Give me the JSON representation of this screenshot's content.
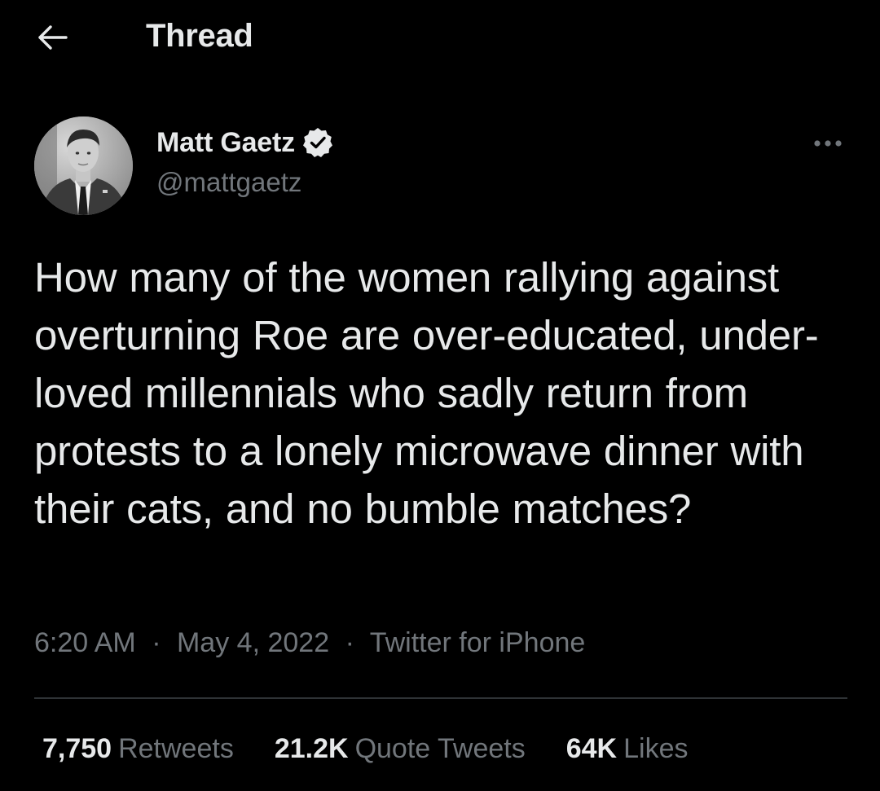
{
  "header": {
    "title": "Thread",
    "back_icon": "arrow-left-icon"
  },
  "author": {
    "display_name": "Matt Gaetz",
    "handle": "@mattgaetz",
    "verified_icon": "verified-badge-icon",
    "more_icon": "more-horizontal-icon"
  },
  "tweet": {
    "text": "How many of the women rallying against overturning Roe are over-educated, under-loved millennials who sadly return from protests to a lonely microwave dinner with their cats, and no bumble matches?",
    "time": "6:20 AM",
    "date": "May 4, 2022",
    "source": "Twitter for iPhone",
    "separator": "·"
  },
  "stats": {
    "retweets": {
      "count": "7,750",
      "label": "Retweets"
    },
    "quote_tweets": {
      "count": "21.2K",
      "label": "Quote Tweets"
    },
    "likes": {
      "count": "64K",
      "label": "Likes"
    }
  },
  "colors": {
    "background": "#000000",
    "text_primary": "#e7e9ea",
    "text_secondary": "#71767b",
    "divider": "#2f3336"
  }
}
